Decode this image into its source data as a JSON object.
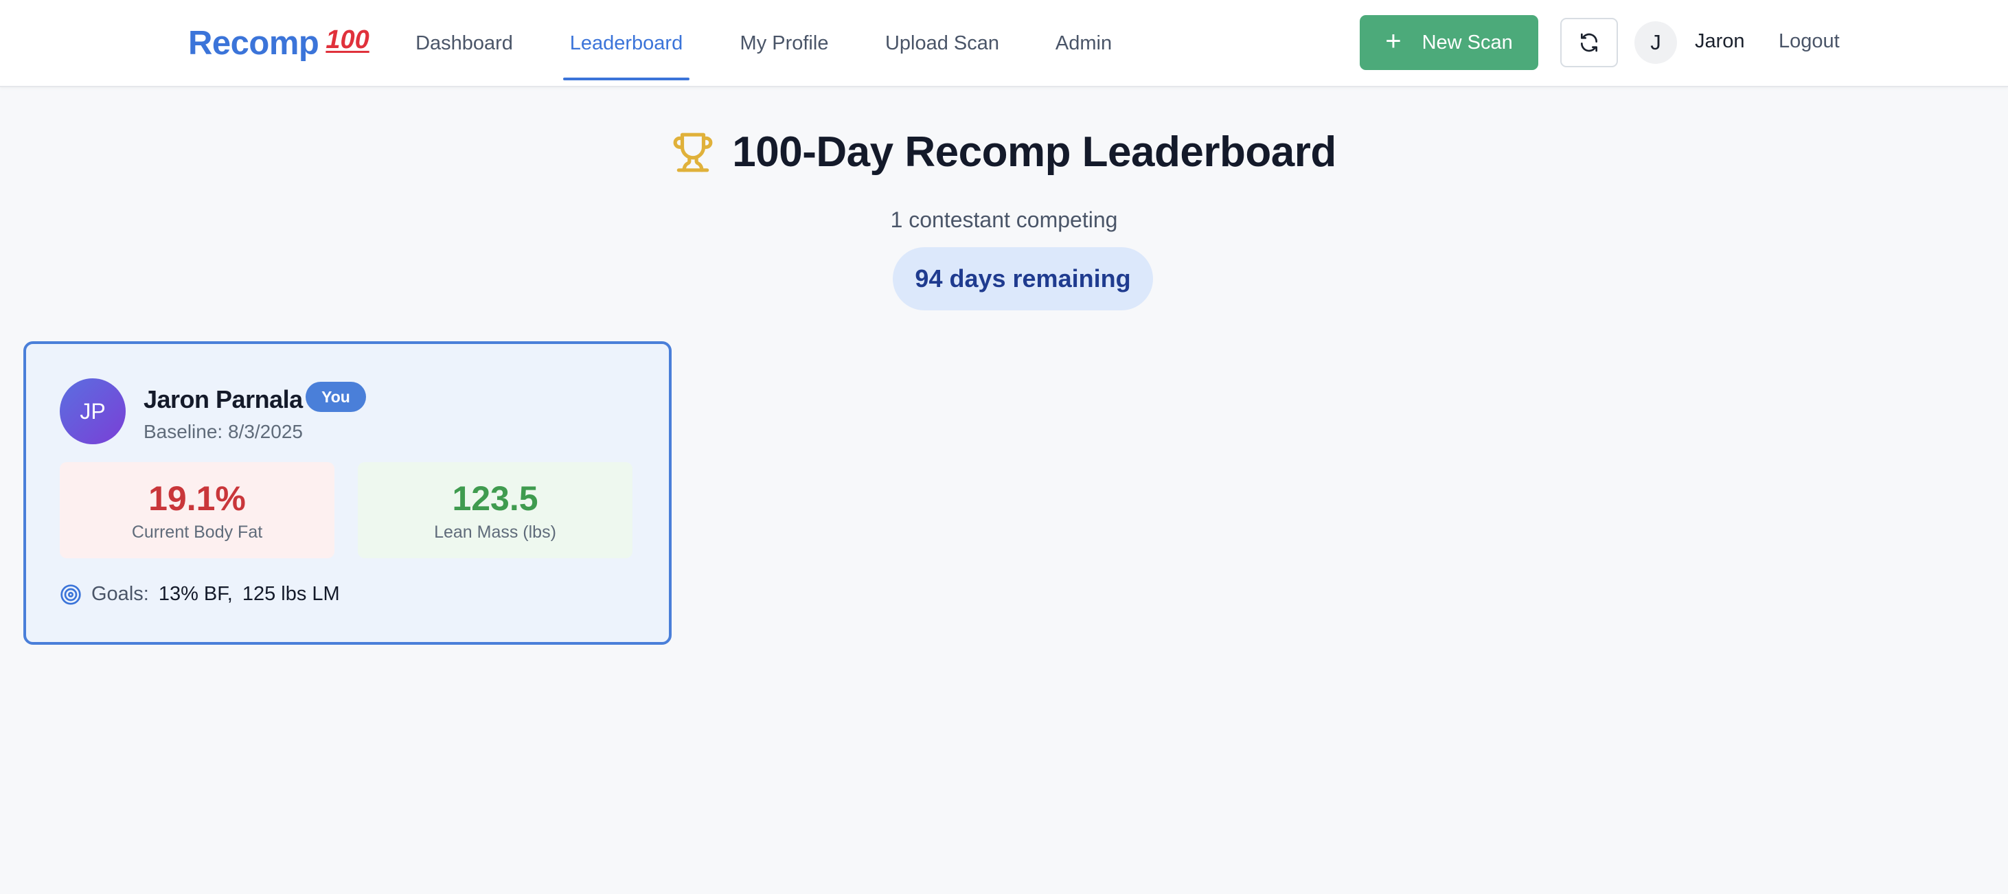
{
  "brand": {
    "name": "Recomp",
    "emoji": "100"
  },
  "nav": {
    "items": [
      {
        "label": "Dashboard"
      },
      {
        "label": "Leaderboard",
        "active": true
      },
      {
        "label": "My Profile"
      },
      {
        "label": "Upload Scan"
      },
      {
        "label": "Admin"
      }
    ]
  },
  "actions": {
    "new_scan_label": "New Scan",
    "refresh_icon": "refresh-icon",
    "user_initial": "J",
    "user_name": "Jaron",
    "logout_label": "Logout"
  },
  "header": {
    "title": "100-Day Recomp Leaderboard",
    "title_icon": "trophy-icon",
    "subtitle": "1 contestant competing",
    "days_remaining": "94 days remaining"
  },
  "contestants": [
    {
      "initials": "JP",
      "name": "Jaron Parnala",
      "badge": "You",
      "baseline": "Baseline: 8/3/2025",
      "body_fat": {
        "value": "19.1%",
        "label": "Current Body Fat"
      },
      "lean_mass": {
        "value": "123.5",
        "label": "Lean Mass (lbs)"
      },
      "goals": {
        "label": "Goals:",
        "bf": "13% BF,",
        "lm": "125 lbs LM"
      }
    }
  ],
  "colors": {
    "accent": "#3b74d9",
    "success": "#4caa7a",
    "body_fat": "#c9363a",
    "lean_mass": "#3f9b4f",
    "trophy": "#e0b13a"
  }
}
